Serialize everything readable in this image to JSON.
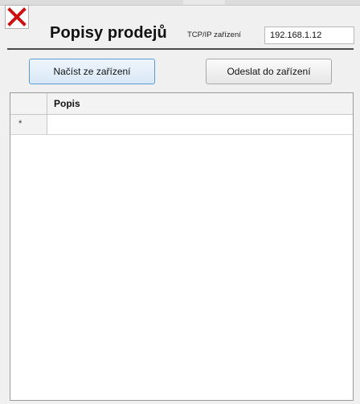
{
  "window": {
    "title": "Popisy prodejů",
    "close_icon": "close-x-icon",
    "close_color": "#cc1111"
  },
  "device": {
    "ip_label": "TCP/IP zařízení",
    "ip_value": "192.168.1.12"
  },
  "toolbar": {
    "load_label": "Načíst ze zařízení",
    "send_label": "Odeslat do zařízení"
  },
  "grid": {
    "columns": [
      {
        "label": "Popis"
      }
    ],
    "new_row_marker": "*"
  }
}
